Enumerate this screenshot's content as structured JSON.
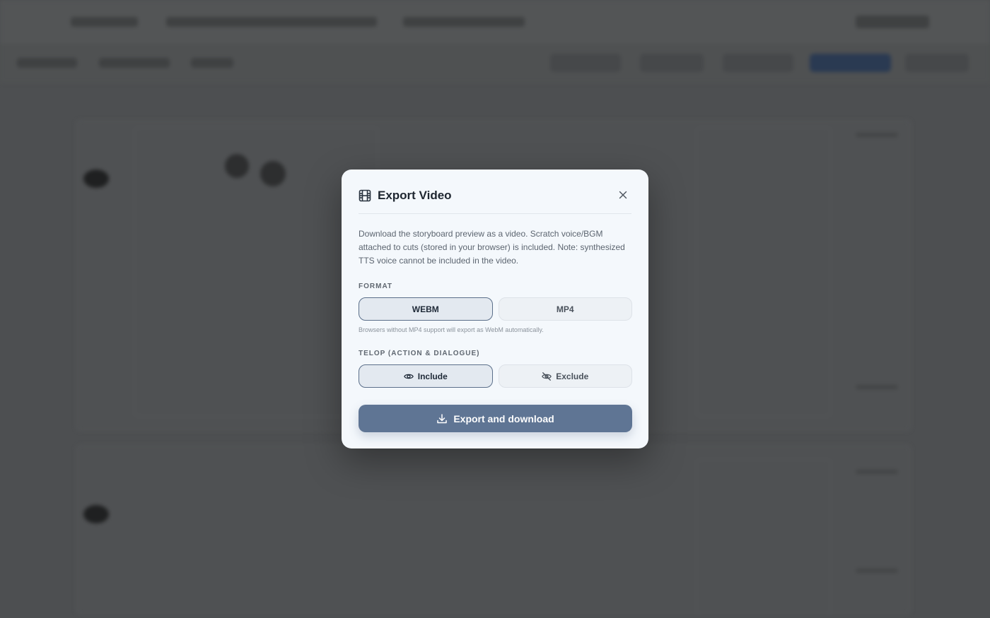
{
  "modal": {
    "title": "Export Video",
    "description": "Download the storyboard preview as a video. Scratch voice/BGM attached to cuts (stored in your browser) is included. Note: synthesized TTS voice cannot be included in the video.",
    "format": {
      "label": "FORMAT",
      "options": [
        "WEBM",
        "MP4"
      ],
      "selected": "WEBM",
      "hint": "Browsers without MP4 support will export as WebM automatically."
    },
    "telop": {
      "label": "TELOP (ACTION & DIALOGUE)",
      "options": [
        "Include",
        "Exclude"
      ],
      "selected": "Include"
    },
    "submit_label": "Export and download",
    "icons": {
      "title": "film-icon",
      "close": "close-icon",
      "include": "eye-icon",
      "exclude": "eye-off-icon",
      "submit": "download-icon"
    }
  },
  "colors": {
    "primary": "#5f7594",
    "active_border": "#5b6f8a",
    "overlay": "#4d4f51"
  }
}
